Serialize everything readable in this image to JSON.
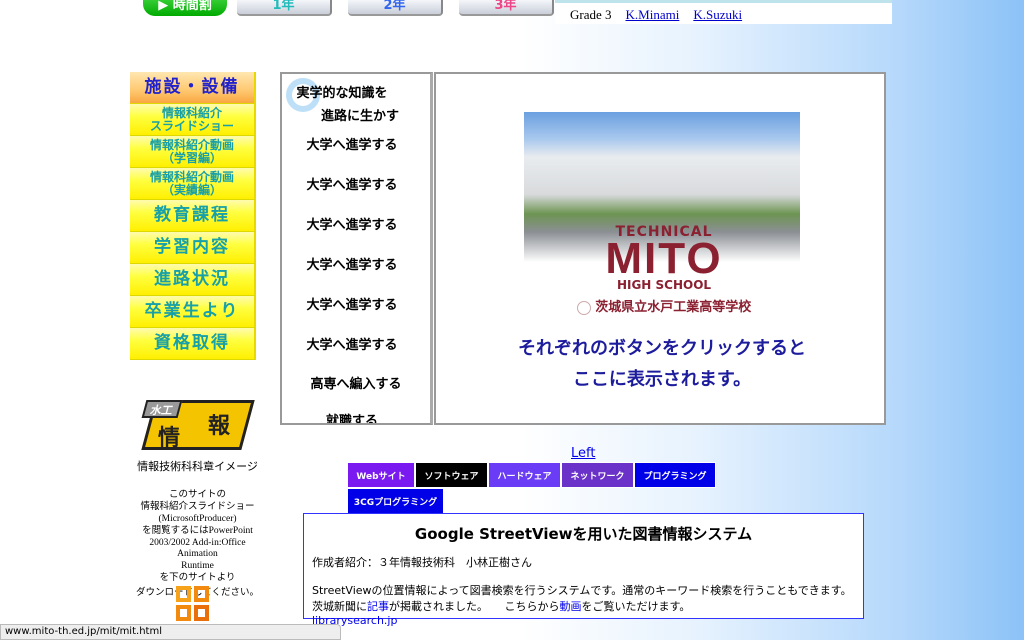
{
  "top": {
    "timetable": "時間割",
    "grade1": "1年",
    "grade2": "2年",
    "grade3": "3年",
    "grade_label": "Grade 3",
    "links": [
      "K.Minami",
      "K.Suzuki"
    ]
  },
  "nav": [
    "施設・設備",
    "情報科紹介\nスライドショー",
    "情報科紹介動画\n（学習編）",
    "情報科紹介動画\n（実績編）",
    "教育課程",
    "学習内容",
    "進路状況",
    "卒業生より",
    "資格取得"
  ],
  "career": {
    "heading1": "実学的な知識を",
    "heading2": "進路に生かす",
    "items": [
      "大学へ進学する",
      "大学へ進学する",
      "大学へ進学する",
      "大学へ進学する",
      "大学へ進学する",
      "大学へ進学する",
      "高専へ編入する",
      "就職する"
    ]
  },
  "main": {
    "logo_top": "TECHNICAL",
    "logo_main": "MITO",
    "logo_bottom": "HIGH SCHOOL",
    "school_name": "茨城県立水戸工業高等学校",
    "message1": "それぞれのボタンをクリックすると",
    "message2": "ここに表示されます。"
  },
  "sidebar": {
    "emblem_text1": "水工",
    "emblem_text2": "情",
    "emblem_text3": "報",
    "emblem_caption": "情報技術科科章イメージ",
    "note": [
      "このサイトの",
      "情報科紹介スライドショー",
      "(MicrosoftProducer)",
      "を閲覧するにはPowerPoint",
      "2003/2002 Add-in:Office Animation",
      "Runtime",
      "を下のサイトより",
      "ダウンロードしてください。"
    ]
  },
  "works": {
    "left_link": "Left",
    "tabs": [
      {
        "label": "Webサイト",
        "color": "#7a1af0"
      },
      {
        "label": "ソフトウェア",
        "color": "#000000"
      },
      {
        "label": "ハードウェア",
        "color": "#6a3cf5"
      },
      {
        "label": "ネットワーク",
        "color": "#6a32c8"
      },
      {
        "label": "プログラミング",
        "color": "#0000e8"
      },
      {
        "label": "3CGプログラミング",
        "color": "#0000e8"
      }
    ],
    "title": "Google StreetViewを用いた図書情報システム",
    "author": "作成者紹介：３年情報技術科　小林正樹さん",
    "desc": "StreetViewの位置情報によって図書検索を行うシステムです。通常のキーワード検索を行うこともできます。",
    "news_pre": "茨城新聞に",
    "news_link": "記事",
    "news_mid": "が掲載されました。　　こちらから",
    "video_link": "動画",
    "news_post": "をご覧いただけます。",
    "site_link": "librarysearch.jp"
  },
  "status_url": "www.mito-th.ed.jp/mit/mit.html"
}
